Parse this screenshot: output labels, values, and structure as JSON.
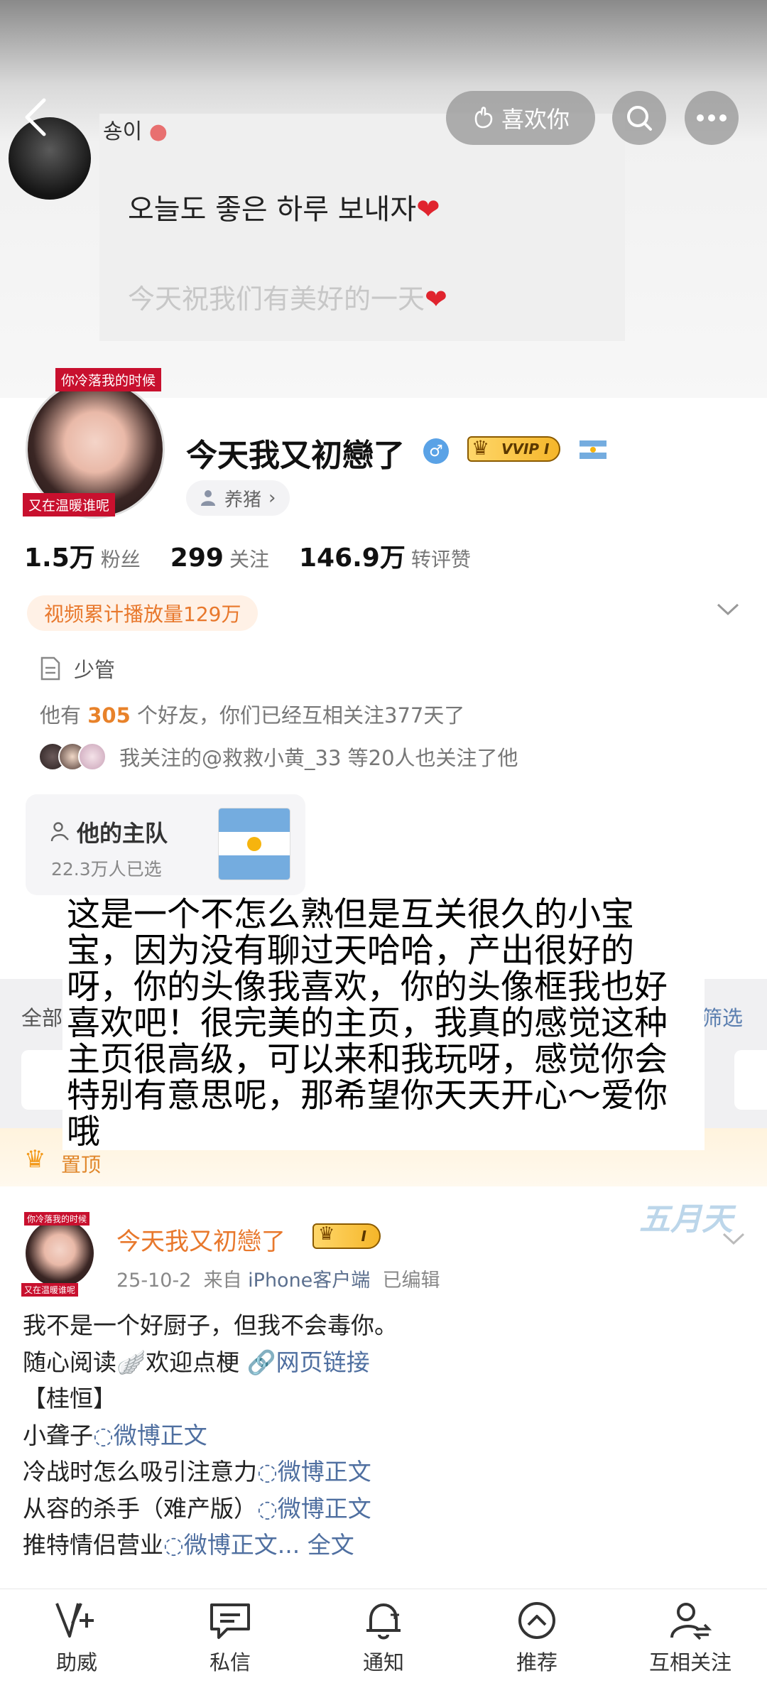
{
  "cover": {
    "username": "숑이",
    "line1": "오늘도 좋은 하루 보내자",
    "line2": "今天祝我们有美好的一天",
    "heart": "❤"
  },
  "header": {
    "like_label": "喜欢你",
    "icons": [
      "back-icon",
      "search-icon",
      "more-icon"
    ]
  },
  "profile": {
    "frame_top": "你冷落我的时候",
    "frame_bottom": "又在温暖谁呢",
    "name": "今天我又初戀了",
    "gender_symbol": "♂",
    "vip_label": "VVIP I",
    "tag": "养猪",
    "tag_chevron": "›"
  },
  "stats": [
    {
      "value": "1.5万",
      "label": "粉丝"
    },
    {
      "value": "299",
      "label": "关注"
    },
    {
      "value": "146.9万",
      "label": "转评赞"
    }
  ],
  "badge": "视频累计播放量129万",
  "note": "少管",
  "friends": {
    "prefix": "他有",
    "count": "305",
    "suffix": "个好友，你们已经互相关注377天了"
  },
  "mutual": "我关注的@救救小黄_33 等20人也关注了他",
  "team": {
    "title": "他的主队",
    "subtitle": "22.3万人已选"
  },
  "filter_bar": {
    "all": "全部",
    "filter": "筛选"
  },
  "pinned": {
    "label": "置顶"
  },
  "overlay_text": "这是一个不怎么熟但是互关很久的小宝宝，因为没有聊过天哈哈，产出很好的呀，你的头像我喜欢，你的头像框我也好喜欢吧！很完美的主页，我真的感觉这种主页很高级，可以来和我玩呀，感觉你会特别有意思呢，那希望你天天开心～爱你哦",
  "post": {
    "frame_top": "你冷落我的时候",
    "frame_bottom": "又在温暖谁呢",
    "author": "今天我又初戀了",
    "vip_label": "I",
    "date": "25-10-2",
    "from": "来自",
    "source": "iPhone客户端",
    "edited": "已编辑",
    "watermark": "五月天",
    "lines": {
      "l1": "我不是一个好厨子，但我不会毒你。",
      "l2_text": "随心阅读🪽欢迎点梗 ",
      "l2_link": "🔗网页链接",
      "l3": "【桂恒】",
      "l4_text": "小聋子",
      "l5_text": "冷战时怎么吸引注意力",
      "l6_text": "从容的杀手（难产版）",
      "l7_text": "推特情侣营业",
      "weibo_link": "微博正文",
      "ellipsis": "...",
      "full_text": "全文"
    }
  },
  "bottom_nav": [
    {
      "label": "助威",
      "icon": "cheer-icon"
    },
    {
      "label": "私信",
      "icon": "message-icon"
    },
    {
      "label": "通知",
      "icon": "bell-icon"
    },
    {
      "label": "推荐",
      "icon": "recommend-icon"
    },
    {
      "label": "互相关注",
      "icon": "mutual-follow-icon"
    }
  ],
  "colors": {
    "accent_orange": "#e8782c",
    "link_blue": "#4f6fa0",
    "frame_red": "#c8102e",
    "gender_blue": "#5aa2e6"
  }
}
